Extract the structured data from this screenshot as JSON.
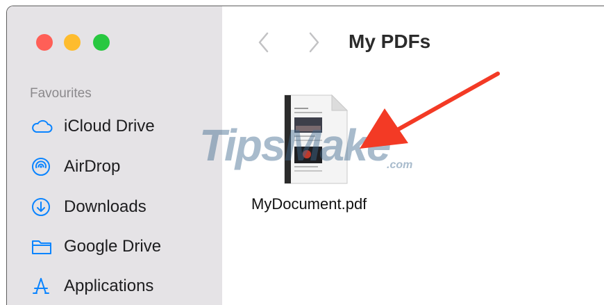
{
  "sidebar": {
    "section_title": "Favourites",
    "items": [
      {
        "label": "iCloud Drive",
        "icon": "cloud-icon"
      },
      {
        "label": "AirDrop",
        "icon": "airdrop-icon"
      },
      {
        "label": "Downloads",
        "icon": "downloads-icon"
      },
      {
        "label": "Google Drive",
        "icon": "folder-icon"
      },
      {
        "label": "Applications",
        "icon": "applications-icon"
      }
    ]
  },
  "toolbar": {
    "title": "My PDFs"
  },
  "files": [
    {
      "name": "MyDocument.pdf",
      "icon": "pdf-document-icon"
    }
  ],
  "watermark": {
    "text": "TipsMake",
    "suffix": ".com"
  },
  "colors": {
    "sidebar_bg": "#e5e3e6",
    "traffic_red": "#ff5f57",
    "traffic_yellow": "#febc2e",
    "traffic_green": "#28c840",
    "icon_blue": "#0a84ff",
    "annotation_arrow": "#f33a25"
  }
}
